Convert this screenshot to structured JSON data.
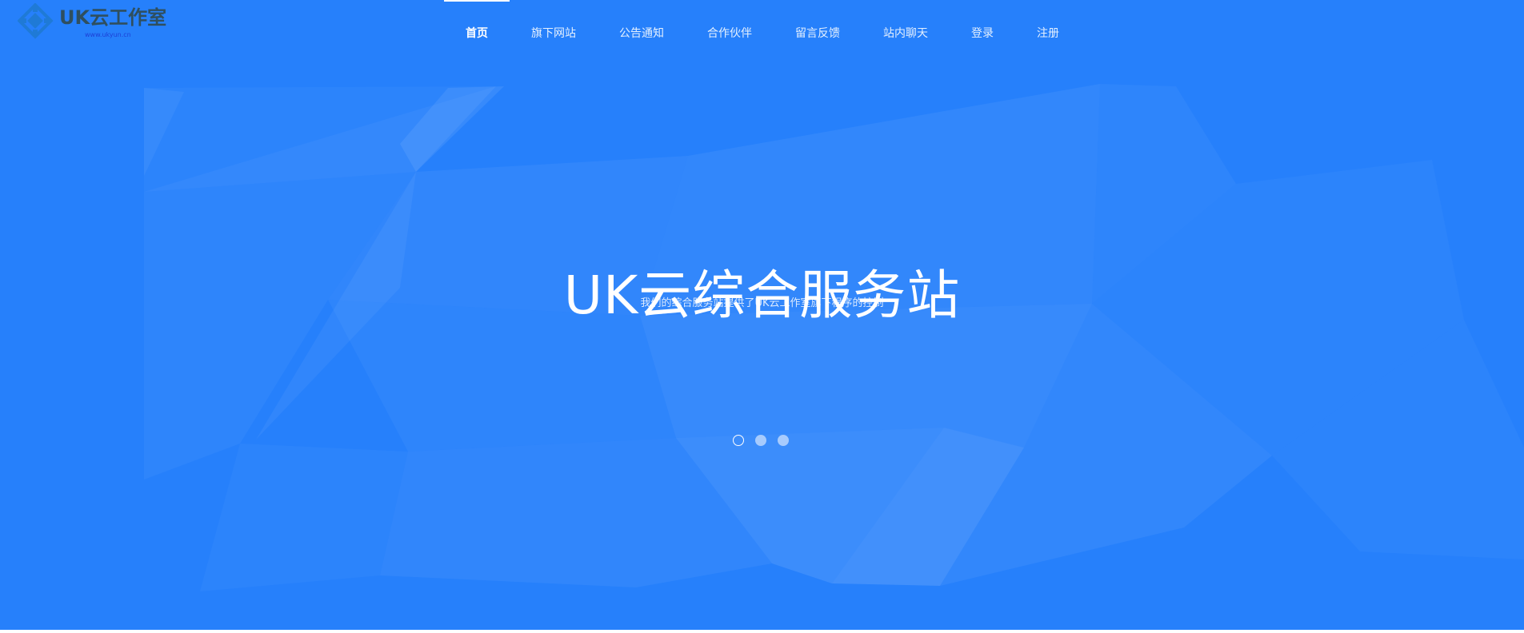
{
  "colors": {
    "hero_background": "#2680fb",
    "logo_mark": "#1f7ad6",
    "logo_text": "#2f4f5f",
    "logo_url": "#1d3fd6"
  },
  "logo": {
    "name": "UK云工作室",
    "url": "www.ukyun.cn"
  },
  "nav": {
    "items": [
      {
        "label": "首页",
        "active": true
      },
      {
        "label": "旗下网站",
        "active": false
      },
      {
        "label": "公告通知",
        "active": false
      },
      {
        "label": "合作伙伴",
        "active": false
      },
      {
        "label": "留言反馈",
        "active": false
      },
      {
        "label": "站内聊天",
        "active": false
      },
      {
        "label": "登录",
        "active": false
      },
      {
        "label": "注册",
        "active": false
      }
    ]
  },
  "hero": {
    "title": "UK云综合服务站",
    "subtitle": "我们的综合服务站提供了UK云工作室旗下程序的控制"
  },
  "carousel": {
    "slide_count": 3,
    "active_index": 0
  }
}
